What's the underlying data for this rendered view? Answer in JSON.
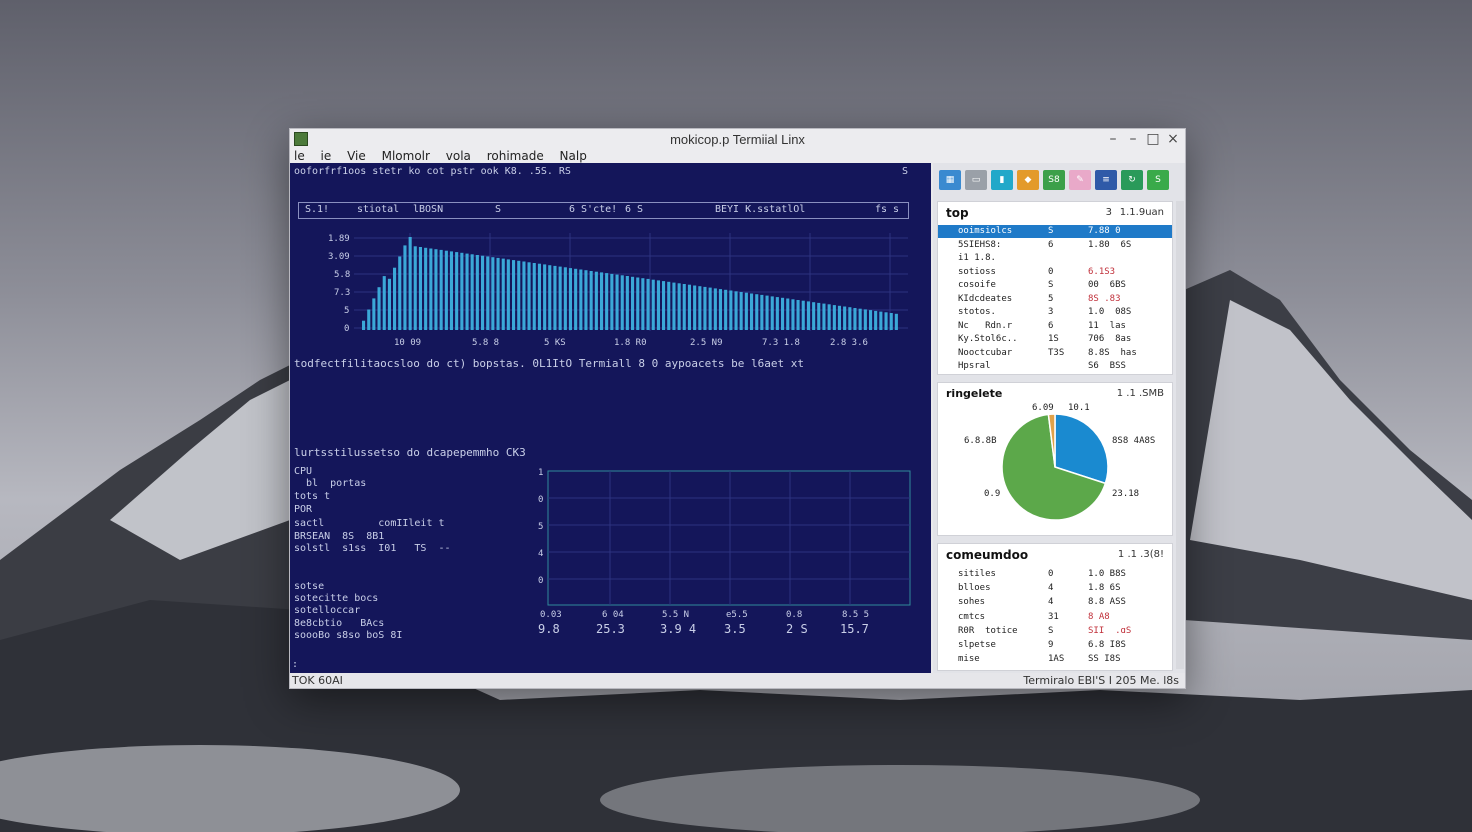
{
  "window": {
    "title": "mokicop.p Termiial Linx",
    "menu": [
      "le",
      "ie",
      "Vie",
      "Mlomolr",
      "vola",
      "rohimade",
      "Nalp"
    ],
    "controls": {
      "minimize": "–",
      "minimize2": "–",
      "maximize": "□",
      "close": "×"
    }
  },
  "terminal": {
    "header_line": "ooforfrf1oos stetr ko cot pstr ook K8. .5S. RS",
    "header_right": "S",
    "stats_cells": [
      "S.1!",
      "stiotal",
      "lBOSN",
      "S",
      "6 S'cte!",
      "6 S",
      "BEYI K.sstatlOl",
      "fs s"
    ],
    "bar_chart": {
      "y_ticks": [
        "1.89",
        "3.09",
        "5.8",
        "7.3",
        "5",
        "0"
      ],
      "x_ticks": [
        "10 09",
        "5.8 8",
        "5 KS",
        "1.8 R0",
        "2.5 N9",
        "7.3 1.8",
        "2.8 3.6"
      ]
    },
    "mid_line": "todfectfilitaocsloo do ct) bopstas. 0L1ItO Termiall 8 0 aypoacets be l6aet xt",
    "section2_title": "lurtsstilussetso do dcapepemmho CK3",
    "left_block": [
      "CPU",
      "  bl  portas",
      "tots t",
      "POR",
      "sactl         comIIleit t",
      "BRSEAN  8S  8B1",
      "solstl  s1ss  I01   TS  --"
    ],
    "left_block2": [
      "sotse",
      "sotecitte bocs",
      "sotelloccar",
      "8e8cbtio   BAcs",
      "soooBo s8so boS 8I"
    ],
    "line_chart": {
      "y_ticks": [
        "1",
        "0",
        "5",
        "4",
        "0"
      ],
      "x_ticks": [
        "0.03",
        "6 04",
        "5.5 N",
        "e5.5",
        "0.8",
        "8.5 5"
      ],
      "x_values": [
        "9.8",
        "25.3",
        "3.9 4",
        "3.5",
        "2 S",
        "15.7"
      ]
    },
    "prompt": ":"
  },
  "status_bar": {
    "left": "TOK 60AI",
    "right": "Termiralo EBl'S I 205 Me. l8s"
  },
  "toolbar_icons": [
    {
      "name": "grid-icon",
      "glyph": "▦",
      "color": "#3a8ad0"
    },
    {
      "name": "image-icon",
      "glyph": "▭",
      "color": "#9aa0a8"
    },
    {
      "name": "terminal-icon",
      "glyph": "▮",
      "color": "#21a8c9"
    },
    {
      "name": "package-icon",
      "glyph": "◆",
      "color": "#e39a2a"
    },
    {
      "name": "sheet-icon",
      "glyph": "S8",
      "color": "#3ca04a"
    },
    {
      "name": "pen-icon",
      "glyph": "✎",
      "color": "#e9a9c9"
    },
    {
      "name": "stack-icon",
      "glyph": "≡",
      "color": "#2f5aa8"
    },
    {
      "name": "refresh-icon",
      "glyph": "↻",
      "color": "#2a9a5a"
    },
    {
      "name": "dollar-icon",
      "glyph": "S",
      "color": "#3aaa4a"
    }
  ],
  "top_panel": {
    "title": "top",
    "meta_num": "3",
    "meta": "1.1.9uan",
    "rows": [
      {
        "name": "ooimsiolcs",
        "c": "S",
        "v": "7.88 0",
        "color": "#ffffff"
      },
      {
        "name": "5SIEHS8:",
        "c": "6",
        "v": "1.80  6S",
        "color": "#222222"
      },
      {
        "name": "i1 1.8.",
        "c": "",
        "v": "",
        "color": "#222222"
      },
      {
        "name": "sotioss",
        "c": "0",
        "v": "6.1S3",
        "color": "#c0303a"
      },
      {
        "name": "cosoife",
        "c": "S",
        "v": "00  6BS",
        "color": "#222222"
      },
      {
        "name": "KIdcdeates",
        "c": "5",
        "v": "8S .83",
        "color": "#c0303a"
      },
      {
        "name": "stotos.",
        "c": "3",
        "v": "1.0  08S",
        "color": "#222222"
      },
      {
        "name": "Nc   Rdn.r",
        "c": "6",
        "v": "11  las",
        "color": "#222222"
      },
      {
        "name": "Ky.Stol6c..",
        "c": "1S",
        "v": "706  8as",
        "color": "#222222"
      },
      {
        "name": "Nooctcubar",
        "c": "T3S",
        "v": "8.8S  has",
        "color": "#222222"
      },
      {
        "name": "Hpsral",
        "c": "",
        "v": "S6  BSS",
        "color": "#222222"
      }
    ]
  },
  "pie_panel": {
    "title": "ringelete",
    "meta": "1 .1 .SMB",
    "labels": {
      "top_left": "6.09",
      "top_right": "10.1",
      "left": "6.8.8B",
      "right": "8S8 4A8S",
      "bottom_left": "0.9",
      "bottom_right": "23.18"
    }
  },
  "chart_data": {
    "type": "pie",
    "slices": [
      {
        "value": 0.3,
        "color": "#1a8ad0"
      },
      {
        "value": 0.68,
        "color": "#5ca84a"
      },
      {
        "value": 0.02,
        "color": "#e0a24a"
      }
    ]
  },
  "cmd_panel": {
    "title": "comeumdoo",
    "meta": "1 .1 .3(8!",
    "rows": [
      {
        "name": "sitiles",
        "c": "0",
        "v": "1.0 B8S",
        "color": "#222222"
      },
      {
        "name": "blloes",
        "c": "4",
        "v": "1.8 6S",
        "color": "#222222"
      },
      {
        "name": "sohes",
        "c": "4",
        "v": "8.8 ASS",
        "color": "#222222"
      },
      {
        "name": "cmtcs",
        "c": "31",
        "v": "8 A8",
        "color": "#c0303a"
      },
      {
        "name": "R0R  totice",
        "c": "S",
        "v": "SII  .ɑS",
        "color": "#c0303a"
      },
      {
        "name": "slpetse",
        "c": "9",
        "v": "6.8 I8S",
        "color": "#222222"
      },
      {
        "name": "mise",
        "c": "1AS",
        "v": "SS I8S",
        "color": "#222222"
      }
    ]
  }
}
